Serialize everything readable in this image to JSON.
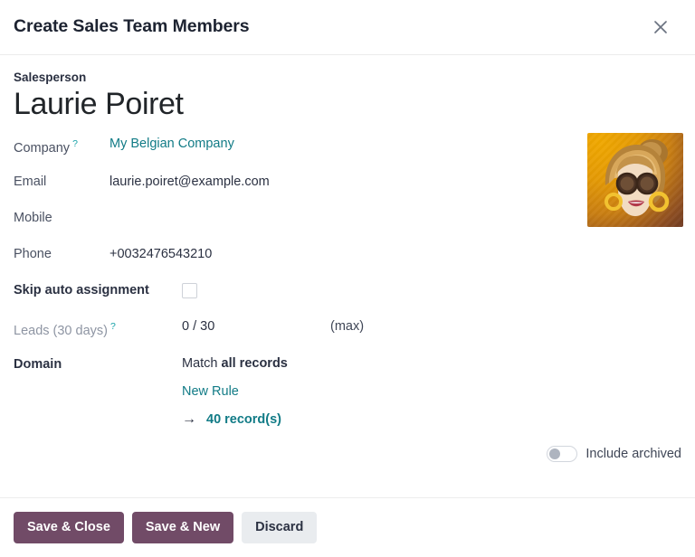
{
  "dialog": {
    "title": "Create Sales Team Members",
    "close_icon": "close-icon"
  },
  "record": {
    "kicker": "Salesperson",
    "name": "Laurie Poiret",
    "avatar_alt": "salesperson-avatar"
  },
  "fields": {
    "company": {
      "label": "Company",
      "help": "?",
      "value": "My Belgian Company"
    },
    "email": {
      "label": "Email",
      "value": "laurie.poiret@example.com"
    },
    "mobile": {
      "label": "Mobile",
      "value": ""
    },
    "phone": {
      "label": "Phone",
      "value": "+0032476543210"
    },
    "skip_auto_assignment": {
      "label": "Skip auto assignment",
      "checked": false
    },
    "leads": {
      "label": "Leads (30 days)",
      "help": "?",
      "value": "0 / 30",
      "note": "(max)"
    },
    "domain": {
      "label": "Domain",
      "match_prefix": "Match",
      "match_target": "all records",
      "new_rule": "New Rule",
      "arrow_icon": "→",
      "record_count": "40 record(s)"
    },
    "include_archived": {
      "label": "Include archived",
      "enabled": false
    }
  },
  "footer": {
    "save_close": "Save & Close",
    "save_new": "Save & New",
    "discard": "Discard"
  },
  "colors": {
    "primary": "#714b67",
    "link": "#117b86",
    "help": "#17a2a8",
    "text": "#2b3142",
    "muted": "#8e95a3"
  }
}
